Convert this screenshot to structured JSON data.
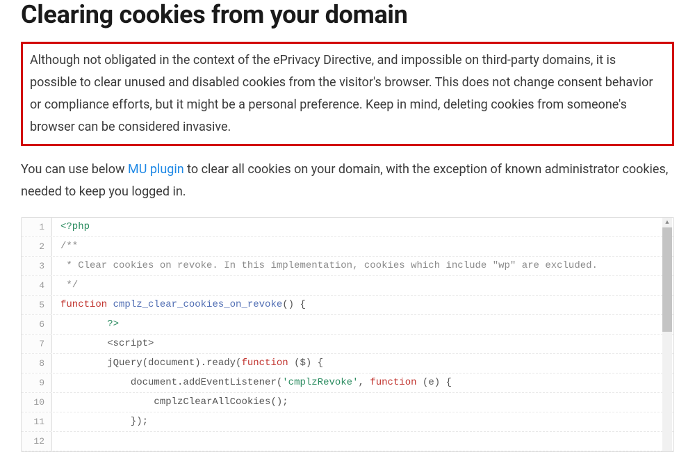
{
  "heading": "Clearing cookies from your domain",
  "highlighted_paragraph": "Although not obligated in the context of the ePrivacy Directive, and impossible on third-party domains, it is possible to clear unused and disabled cookies from the visitor's browser. This does not change consent behavior or compliance efforts, but it might be a personal preference. Keep in mind, deleting cookies from someone's browser can be considered invasive.",
  "intro_before": "You can use below ",
  "intro_link": "MU plugin",
  "intro_after": " to clear all cookies on your domain, with the exception of known administrator cookies, needed to keep you logged in.",
  "code": {
    "lines": [
      {
        "no": "1",
        "tokens": [
          {
            "cls": "tok-tag",
            "t": "<?php"
          }
        ]
      },
      {
        "no": "2",
        "tokens": [
          {
            "cls": "tok-cmt",
            "t": "/**"
          }
        ]
      },
      {
        "no": "3",
        "tokens": [
          {
            "cls": "tok-cmt",
            "t": " * Clear cookies on revoke. In this implementation, cookies which include \"wp\" are excluded."
          }
        ]
      },
      {
        "no": "4",
        "tokens": [
          {
            "cls": "tok-cmt",
            "t": " */"
          }
        ]
      },
      {
        "no": "5",
        "tokens": [
          {
            "cls": "tok-kw",
            "t": "function"
          },
          {
            "cls": "",
            "t": " "
          },
          {
            "cls": "tok-fn",
            "t": "cmplz_clear_cookies_on_revoke"
          },
          {
            "cls": "",
            "t": "() {"
          }
        ]
      },
      {
        "no": "6",
        "tokens": [
          {
            "cls": "",
            "t": "        "
          },
          {
            "cls": "tok-tag",
            "t": "?>"
          }
        ]
      },
      {
        "no": "7",
        "tokens": [
          {
            "cls": "",
            "t": "        <script>"
          }
        ]
      },
      {
        "no": "8",
        "tokens": [
          {
            "cls": "",
            "t": "        jQuery(document).ready("
          },
          {
            "cls": "tok-kw",
            "t": "function"
          },
          {
            "cls": "",
            "t": " ($) {"
          }
        ]
      },
      {
        "no": "9",
        "tokens": [
          {
            "cls": "",
            "t": "            document.addEventListener("
          },
          {
            "cls": "tok-str",
            "t": "'cmplzRevoke'"
          },
          {
            "cls": "",
            "t": ", "
          },
          {
            "cls": "tok-kw",
            "t": "function"
          },
          {
            "cls": "",
            "t": " (e) {"
          }
        ]
      },
      {
        "no": "10",
        "tokens": [
          {
            "cls": "",
            "t": "                cmplzClearAllCookies();"
          }
        ]
      },
      {
        "no": "11",
        "tokens": [
          {
            "cls": "",
            "t": "            });"
          }
        ]
      },
      {
        "no": "12",
        "tokens": [
          {
            "cls": "",
            "t": ""
          }
        ]
      }
    ]
  }
}
